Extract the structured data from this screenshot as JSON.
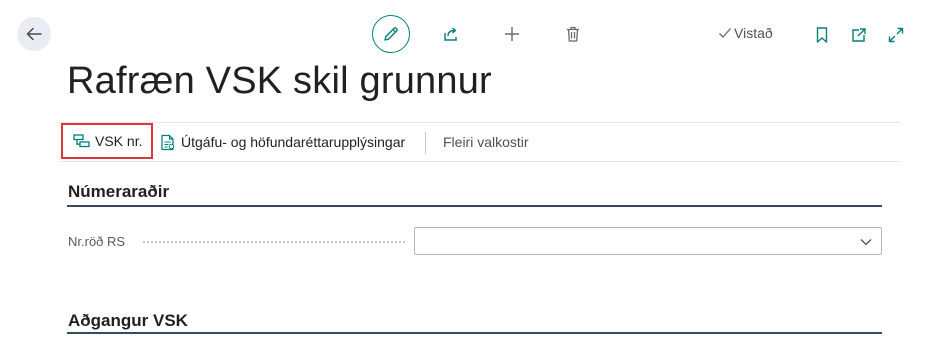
{
  "header": {
    "back_icon": "arrow-left-icon",
    "actions": {
      "edit_icon": "pencil-icon",
      "share_icon": "share-icon",
      "new_icon": "plus-icon",
      "delete_icon": "trash-icon"
    },
    "saved_label": "Vistað",
    "right_icons": [
      "bookmark-icon",
      "open-new-window-icon",
      "expand-icon"
    ]
  },
  "page": {
    "title": "Rafræn VSK skil grunnur"
  },
  "action_bar": {
    "vsk_label": "VSK nr.",
    "utgafu_label": "Útgáfu- og höfundaréttarupplýsingar",
    "more_label": "Fleiri valkostir"
  },
  "sections": {
    "numeraradir": {
      "title": "Númeraraðir",
      "fields": {
        "nr_rod_rs": {
          "label": "Nr.röð RS",
          "value": ""
        }
      }
    },
    "adgangur": {
      "title": "Aðgangur VSK"
    }
  },
  "colors": {
    "accent": "#00807a",
    "highlight_border": "#e0353a",
    "section_line": "#3a4a5c",
    "icon_teal": "#00807a"
  }
}
